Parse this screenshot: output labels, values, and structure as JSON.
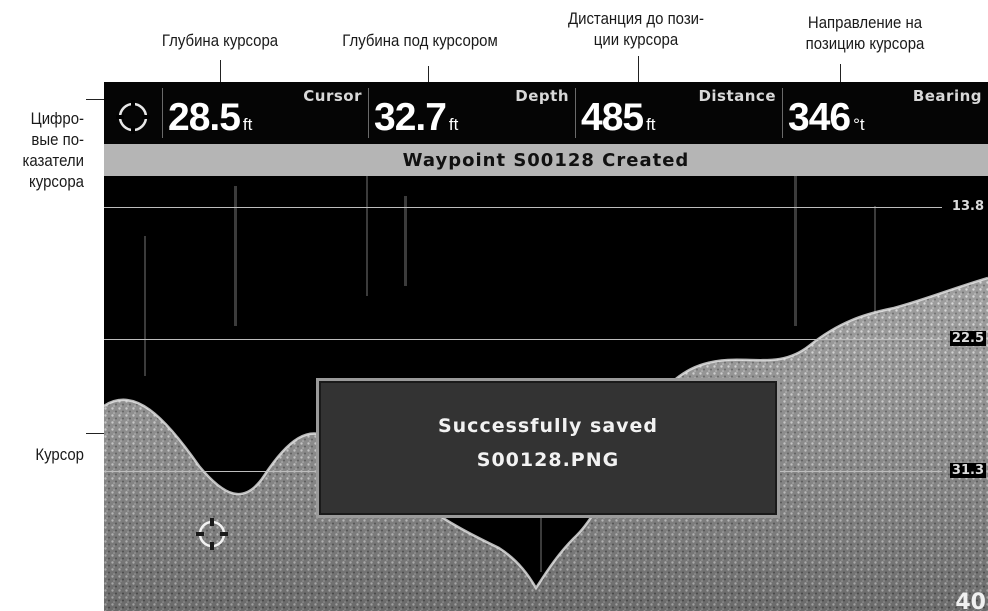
{
  "callouts": {
    "cursor_depth": "Глубина курсора",
    "depth_under_cursor": "Глубина под курсором",
    "distance_line1": "Дистанция до пози-",
    "distance_line2": "ции курсора",
    "bearing_line1": "Направление на",
    "bearing_line2": "позицию курсора",
    "readouts_line1": "Цифро-",
    "readouts_line2": "вые по-",
    "readouts_line3": "казатели",
    "readouts_line4": "курсора",
    "cursor": "Курсор"
  },
  "databar": {
    "cursor": {
      "value": "28.5",
      "unit": "ft",
      "caption": "Cursor"
    },
    "depth": {
      "value": "32.7",
      "unit": "ft",
      "caption": "Depth"
    },
    "distance": {
      "value": "485",
      "unit": "ft",
      "caption": "Distance"
    },
    "bearing": {
      "value": "346",
      "unit": "°t",
      "caption": "Bearing"
    }
  },
  "banner": "Waypoint S00128 Created",
  "dialog": {
    "line1": "Successfully saved",
    "line2": "S00128.PNG"
  },
  "depth_scale": {
    "line1": "13.8",
    "line2": "22.5",
    "line3": "31.3",
    "max": "40"
  },
  "icons": {
    "cursor_readout": "crosshair-cursor-icon",
    "map_cursor": "crosshair-cursor-icon"
  },
  "colors": {
    "screen_bg": "#000000",
    "banner_bg": "#b5b5b5",
    "dialog_bg": "#333333"
  }
}
